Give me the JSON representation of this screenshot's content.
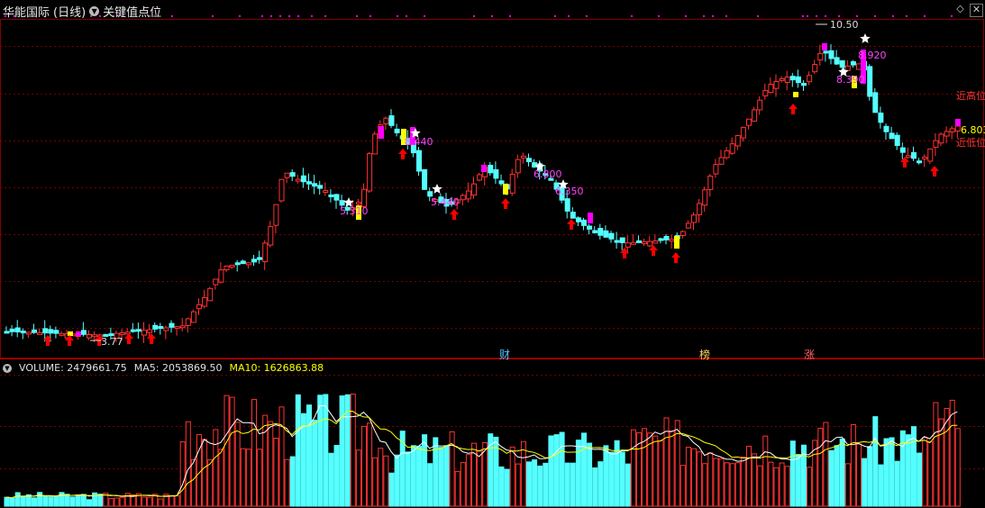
{
  "header": {
    "stock_name": "华能国际",
    "period": "(日线)",
    "indicator_name": "关键值点位"
  },
  "window_buttons": {
    "diamond": "◇",
    "close": "✕"
  },
  "price_panel": {
    "high_label": "10.50",
    "low_label": "3.77",
    "right_labels": {
      "near_high": "近高位",
      "near_low": "近低位",
      "last_value": "6.803"
    },
    "key_values": [
      {
        "text": "8.920"
      },
      {
        "text": "8.440"
      },
      {
        "text": "6.800"
      },
      {
        "text": "6.350"
      },
      {
        "text": "5.440"
      },
      {
        "text": "5.310"
      },
      {
        "text": "8.390"
      }
    ],
    "events": [
      {
        "text": "财"
      },
      {
        "text": "榜"
      },
      {
        "text": "涨"
      }
    ],
    "colors": {
      "up": "#ff3232",
      "down": "#54ffff",
      "ma5": "#ffffff",
      "ma10": "#ffff00",
      "grid": "#7a0000",
      "magenta": "#ff00ff",
      "yellow": "#ffff00",
      "arrow": "#ff0000"
    }
  },
  "volume_panel": {
    "volume_label": "VOLUME: 2479661.75",
    "ma5_label": "MA5: 2053869.50",
    "ma10_label": "MA10: 1626863.88"
  }
}
